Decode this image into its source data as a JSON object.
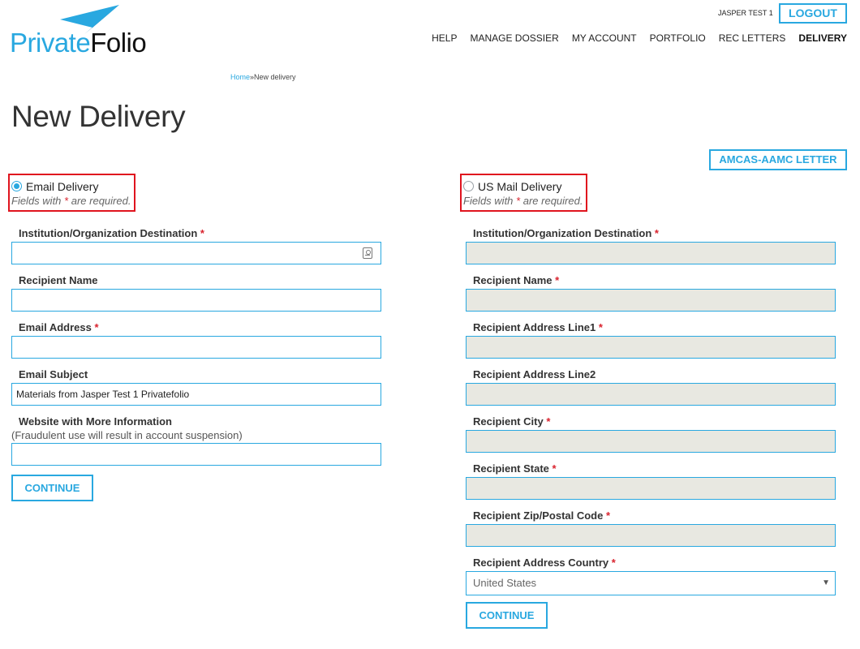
{
  "brand": {
    "part1": "Private",
    "part2": "Folio",
    "accent_color": "#29a8e0",
    "logo_icon": "paper-plane-icon"
  },
  "header": {
    "user_name": "JASPER TEST 1",
    "logout_label": "LOGOUT"
  },
  "nav": {
    "items": [
      "HELP",
      "MANAGE DOSSIER",
      "MY ACCOUNT",
      "PORTFOLIO",
      "REC LETTERS",
      "DELIVERY"
    ],
    "active": "DELIVERY"
  },
  "breadcrumb": {
    "home": "Home",
    "separator": "»",
    "current": "New delivery"
  },
  "page": {
    "title": "New Delivery",
    "amcas_button": "AMCAS-AAMC LETTER"
  },
  "email_delivery": {
    "label": "Email Delivery",
    "selected": true,
    "req_prefix": "Fields with",
    "req_asterisk": "*",
    "req_suffix": "are required.",
    "fields": [
      {
        "label": "Institution/Organization Destination",
        "required": true,
        "value": ""
      },
      {
        "label": "Recipient Name",
        "required": false,
        "value": ""
      },
      {
        "label": "Email Address",
        "required": true,
        "value": ""
      },
      {
        "label": "Email Subject",
        "required": false,
        "value": "Materials from Jasper Test 1 Privatefolio"
      },
      {
        "label": "Website with More Information",
        "required": false,
        "value": "",
        "note": "(Fraudulent use will result in account suspension)"
      }
    ],
    "continue_label": "CONTINUE"
  },
  "mail_delivery": {
    "label": "US Mail Delivery",
    "selected": false,
    "req_prefix": "Fields with",
    "req_asterisk": "*",
    "req_suffix": "are required.",
    "fields": [
      {
        "label": "Institution/Organization Destination",
        "required": true,
        "value": ""
      },
      {
        "label": "Recipient Name",
        "required": true,
        "value": ""
      },
      {
        "label": "Recipient Address Line1",
        "required": true,
        "value": ""
      },
      {
        "label": "Recipient Address Line2",
        "required": false,
        "value": ""
      },
      {
        "label": "Recipient City",
        "required": true,
        "value": ""
      },
      {
        "label": "Recipient State",
        "required": true,
        "value": ""
      },
      {
        "label": "Recipient Zip/Postal Code",
        "required": true,
        "value": ""
      }
    ],
    "country": {
      "label": "Recipient Address Country",
      "required": true,
      "value": "United States"
    },
    "continue_label": "CONTINUE"
  }
}
